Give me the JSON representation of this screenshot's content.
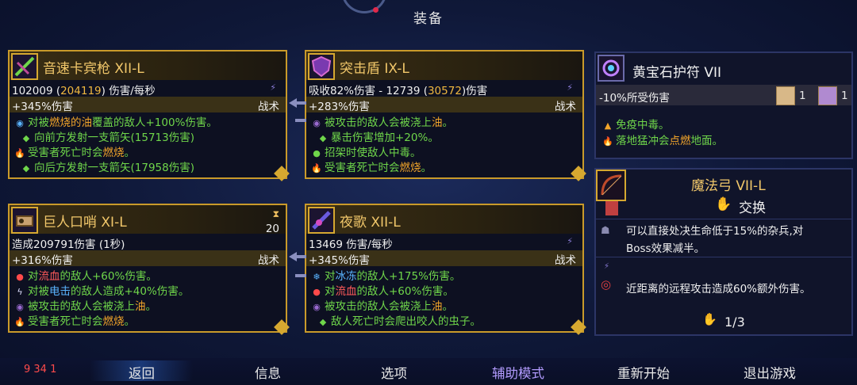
{
  "header": {
    "title": "装备"
  },
  "cards": [
    {
      "name": "音速卡宾枪 XII-L",
      "stat_a": "102009 (",
      "stat_hl": "204119",
      "stat_b": ") 伤害/每秒",
      "bonus": "+345%伤害",
      "class": "战术",
      "effects": [
        {
          "pre": "对被",
          "kw": "燃烧的油",
          "post": "覆盖的敌人+100%伤害。"
        },
        {
          "pre": "向前方发射一支箭矢(15713伤害)",
          "kw": "",
          "post": ""
        },
        {
          "pre": "受害者死亡时会",
          "kw": "燃烧",
          "post": "。"
        },
        {
          "pre": "向后方发射一支箭矢(17958伤害)",
          "kw": "",
          "post": ""
        }
      ]
    },
    {
      "name": "突击盾 IX-L",
      "stat_a": "吸收82%伤害 - 12739 (",
      "stat_hl": "30572",
      "stat_b": ")伤害",
      "bonus": "+283%伤害",
      "class": "战术",
      "effects": [
        {
          "pre": "被攻击的敌人会被浇上",
          "kw": "油",
          "post": "。"
        },
        {
          "pre": "暴击伤害增加+20%。",
          "kw": "",
          "post": ""
        },
        {
          "pre": "招架时使敌人中毒。",
          "kw": "",
          "post": ""
        },
        {
          "pre": "受害者死亡时会",
          "kw": "燃烧",
          "post": "。"
        }
      ]
    },
    {
      "name": "巨人口哨 XI-L",
      "stat_a": "造成209791伤害 (1秒)",
      "stat_hl": "",
      "stat_b": "",
      "bonus": "+316%伤害",
      "class": "战术",
      "timer": "20",
      "effects": [
        {
          "pre": "对",
          "kw": "流血",
          "post": "的敌人+60%伤害。"
        },
        {
          "pre": "对被",
          "kw": "电击",
          "post": "的敌人造成+40%伤害。"
        },
        {
          "pre": "被攻击的敌人会被浇上",
          "kw": "油",
          "post": "。"
        },
        {
          "pre": "受害者死亡时会",
          "kw": "燃烧",
          "post": "。"
        }
      ]
    },
    {
      "name": "夜歌 XII-L",
      "stat_a": "13469 伤害/每秒",
      "stat_hl": "",
      "stat_b": "",
      "bonus": "+345%伤害",
      "class": "战术",
      "effects": [
        {
          "pre": "对",
          "kw": "冰冻",
          "post": "的敌人+175%伤害。"
        },
        {
          "pre": "对",
          "kw": "流血",
          "post": "的敌人+60%伤害。"
        },
        {
          "pre": "被攻击的敌人会被浇上",
          "kw": "油",
          "post": "。"
        },
        {
          "pre": "敌人死亡时会爬出咬人的虫子。",
          "kw": "",
          "post": ""
        }
      ]
    }
  ],
  "amulet": {
    "name": "黄宝石护符 VII",
    "stat": "-10%所受伤害",
    "scroll1": "1",
    "scroll2": "1",
    "eff1": "免疫中毒。",
    "eff2_pre": "落地猛冲会",
    "eff2_kw": "点燃",
    "eff2_post": "地面。"
  },
  "bow": {
    "name": "魔法弓 VII-L",
    "swap": "交换",
    "desc1": "可以直接处决生命低于15%的杂兵,对",
    "desc2": "Boss效果减半。",
    "desc3": "近距离的远程攻击造成60%额外伤害。",
    "page": "1/3"
  },
  "bottom": {
    "stats": "9 34 1",
    "menu": [
      "返回",
      "信息",
      "选项",
      "辅助模式",
      "重新开始",
      "退出游戏"
    ]
  },
  "colors": {
    "gold": "#c99a2a",
    "menu_active": "#b39cff"
  }
}
